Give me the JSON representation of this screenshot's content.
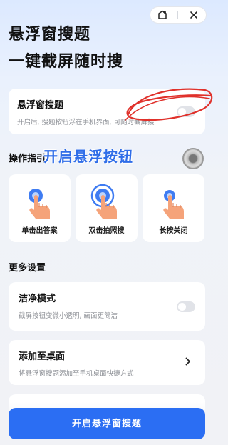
{
  "hero": {
    "title": "悬浮窗搜题",
    "subtitle": "一键截屏随时搜"
  },
  "top_bar": {
    "icons": [
      "add-to-home-icon",
      "close-icon"
    ]
  },
  "float_toggle": {
    "title": "悬浮窗搜题",
    "description": "开启后, 搜题按钮浮在手机界面, 可随时截屏搜",
    "enabled": false
  },
  "overlay": {
    "text": "开启悬浮按钮"
  },
  "operations": {
    "title": "操作指引",
    "items": [
      {
        "label": "单击出答案",
        "icon": "single-tap-icon"
      },
      {
        "label": "双击拍照搜",
        "icon": "double-tap-icon"
      },
      {
        "label": "长按关闭",
        "icon": "long-press-icon"
      }
    ]
  },
  "more_settings": {
    "title": "更多设置",
    "clean_mode": {
      "title": "洁净模式",
      "description": "截屏按钮变微小透明, 画面更简洁",
      "enabled": false
    },
    "add_to_desktop": {
      "title": "添加至桌面",
      "description": "将悬浮窗搜题添加至手机桌面快捷方式"
    }
  },
  "primary_button": {
    "label": "开启悬浮窗搜题"
  },
  "colors": {
    "accent": "#2b6ef3",
    "overlay_text": "#2f6de8",
    "annotation_red": "#e0312b"
  }
}
